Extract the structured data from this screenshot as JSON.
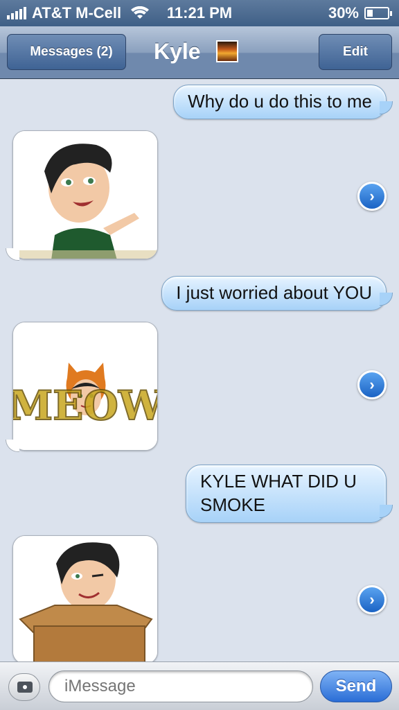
{
  "status_bar": {
    "carrier": "AT&T M-Cell",
    "time": "11:21 PM",
    "battery_percent": "30%",
    "battery_level": 0.3
  },
  "nav": {
    "back_label": "Messages (2)",
    "title": "Kyle",
    "edit_label": "Edit"
  },
  "messages": [
    {
      "direction": "outgoing",
      "type": "text",
      "text": "Why do u do this to me"
    },
    {
      "direction": "incoming",
      "type": "image",
      "image": "bitmoji-waving"
    },
    {
      "direction": "outgoing",
      "type": "text",
      "text": "I just worried about YOU"
    },
    {
      "direction": "incoming",
      "type": "image",
      "image": "bitmoji-meow",
      "image_text": "MEOW"
    },
    {
      "direction": "outgoing",
      "type": "text",
      "text": "KYLE WHAT DID U SMOKE"
    },
    {
      "direction": "incoming",
      "type": "image",
      "image": "bitmoji-box"
    }
  ],
  "input_bar": {
    "placeholder": "iMessage",
    "send_label": "Send"
  },
  "colors": {
    "background": "#dbe2ed",
    "outgoing_bubble": "#a7d2f8",
    "accent": "#2a6dd6"
  }
}
